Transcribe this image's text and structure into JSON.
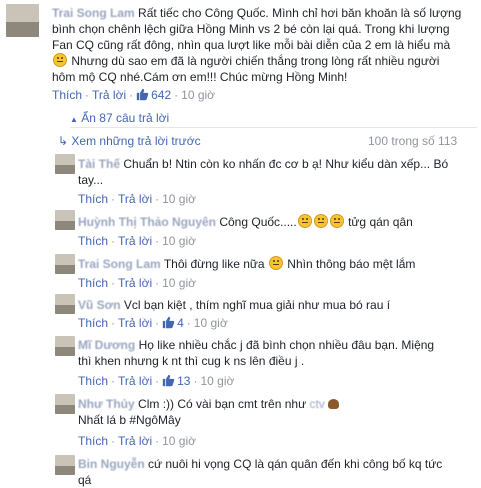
{
  "main_comment": {
    "author": "Trai Song Lam",
    "text_line1": "Rất tiếc cho Công Quốc. Mình chỉ hơi băn khoăn là số lượng",
    "text_line2": "bình chọn chênh lệch giữa Hồng Minh vs 2 bé còn lại quá. Trong khi lượng",
    "text_line3": "Fan CQ cũng rất đông, nhìn qua lượt like mỗi bài diễn của 2 em là hiểu mà",
    "text_line4": " Nhưng dù sao em đã là người chiến thắng trong lòng rất nhiều người",
    "text_line5": "hôm mộ CQ nhé.Cám ơn em!!! Chúc mừng Hồng Minh!",
    "like": "Thích",
    "reply": "Trả lời",
    "likes": "642",
    "time": "10 giờ"
  },
  "hide_replies": "Ẩn 87 câu trả lời",
  "view_previous": "Xem những trả lời trước",
  "count": "100 trong số 113",
  "replies": [
    {
      "author": "Tài Thế",
      "line1": "Chuẩn b! Ntin còn ko nhấn đc cơ b ạ! Như kiểu dàn xếp... Bó",
      "line2": "tay...",
      "like": "Thích",
      "reply": "Trả lời",
      "time": "10 giờ"
    },
    {
      "author": "Huỳnh Thị Thảo Nguyên",
      "line1": "Công Quốc.....",
      "line1b": "tửg qán qân",
      "like": "Thích",
      "reply": "Trả lời",
      "time": "10 giờ"
    },
    {
      "author": "Trai Song Lam",
      "line1": "Thôi đừng like nữa",
      "line1b": "Nhìn thông báo mệt lắm",
      "like": "Thích",
      "reply": "Trả lời",
      "time": "10 giờ"
    },
    {
      "author": "Vũ Sơn",
      "line1": "Vcl bạn kiệt , thím nghĩ mua giải như mua bó rau í",
      "like": "Thích",
      "reply": "Trả lời",
      "likes": "4",
      "time": "10 giờ"
    },
    {
      "author": "Mĩ Dương",
      "line1": "Họ like nhiều chắc j đã bình chọn nhiều đâu bạn. Miệng",
      "line2": "thì khen nhưng k nt thì cug k ns lên điều j .",
      "like": "Thích",
      "reply": "Trả lời",
      "likes": "13",
      "time": "10 giờ"
    },
    {
      "author": "Như Thủy",
      "line1": "Clm :)) Có vài bạn cmt trên như",
      "line1b": "ctv",
      "line2": "Nhất lá b #NgôMây",
      "like": "Thích",
      "reply": "Trả lời",
      "time": "10 giờ"
    },
    {
      "author": "Bin Nguyễn",
      "line1": "cứ nuôi hi vọng CQ là qán quân đến khi công bố kq tức",
      "line2": "qá"
    }
  ]
}
